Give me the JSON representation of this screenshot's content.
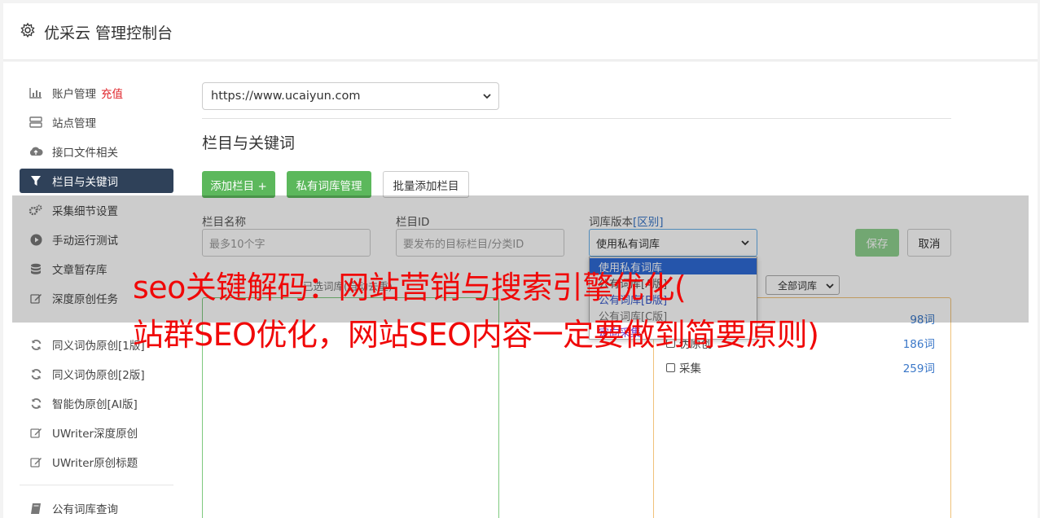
{
  "header": {
    "title": "优采云 管理控制台"
  },
  "sidebar": {
    "items": [
      {
        "label": "账户管理",
        "badge": "充值",
        "icon": "bar-chart-icon"
      },
      {
        "label": "站点管理",
        "icon": "server-icon"
      },
      {
        "label": "接口文件相关",
        "icon": "cloud-upload-icon"
      },
      {
        "label": "栏目与关键词",
        "icon": "filter-icon"
      },
      {
        "label": "采集细节设置",
        "icon": "cogs-icon"
      },
      {
        "label": "手动运行测试",
        "icon": "play-circle-icon"
      },
      {
        "label": "文章暂存库",
        "icon": "database-icon"
      },
      {
        "label": "深度原创任务",
        "icon": "edit-icon"
      },
      {
        "label": "同义词伪原创[1版]",
        "icon": "refresh-icon"
      },
      {
        "label": "同义词伪原创[2版]",
        "icon": "refresh-icon"
      },
      {
        "label": "智能伪原创[AI版]",
        "icon": "refresh-icon"
      },
      {
        "label": "UWriter深度原创",
        "icon": "edit-icon"
      },
      {
        "label": "UWriter原创标题",
        "icon": "edit-icon"
      },
      {
        "label": "公有词库查询",
        "icon": "book-icon"
      }
    ]
  },
  "main": {
    "site_select": "https://www.ucaiyun.com",
    "section_title": "栏目与关键词",
    "buttons": {
      "add_column": "添加栏目 +",
      "private_lib": "私有词库管理",
      "batch_add": "批量添加栏目",
      "save": "保存",
      "cancel": "取消"
    },
    "form": {
      "name_label": "栏目名称",
      "name_placeholder": "最多10个字",
      "id_label": "栏目ID",
      "id_placeholder": "要发布的目标栏目/分类ID",
      "version_label": "词库版本",
      "version_diff": "[区别]",
      "version_value": "使用私有词库",
      "version_options": [
        "使用私有词库",
        "公有词库[A版]",
        "公有词库[B版]",
        "公有词库[C版]",
        "定向采集"
      ],
      "lib_filter_label": "已选词库(自动去重)",
      "lib_filter_value": "全部词库"
    },
    "libraries": [
      {
        "name": "",
        "count": "98词"
      },
      {
        "name": "伪原创",
        "count": "186词"
      },
      {
        "name": "采集",
        "count": "259词"
      }
    ]
  },
  "overlay": {
    "line1": "seo关键解码：网站营销与搜索引擎优化(",
    "line2": "站群SEO优化，网站SEO内容一定要做到简要原则)"
  },
  "colors": {
    "accent_green": "#5cb85c",
    "sidebar_active": "#2f4159",
    "overlay_text": "#f00808",
    "link_blue": "#3a77c8"
  }
}
